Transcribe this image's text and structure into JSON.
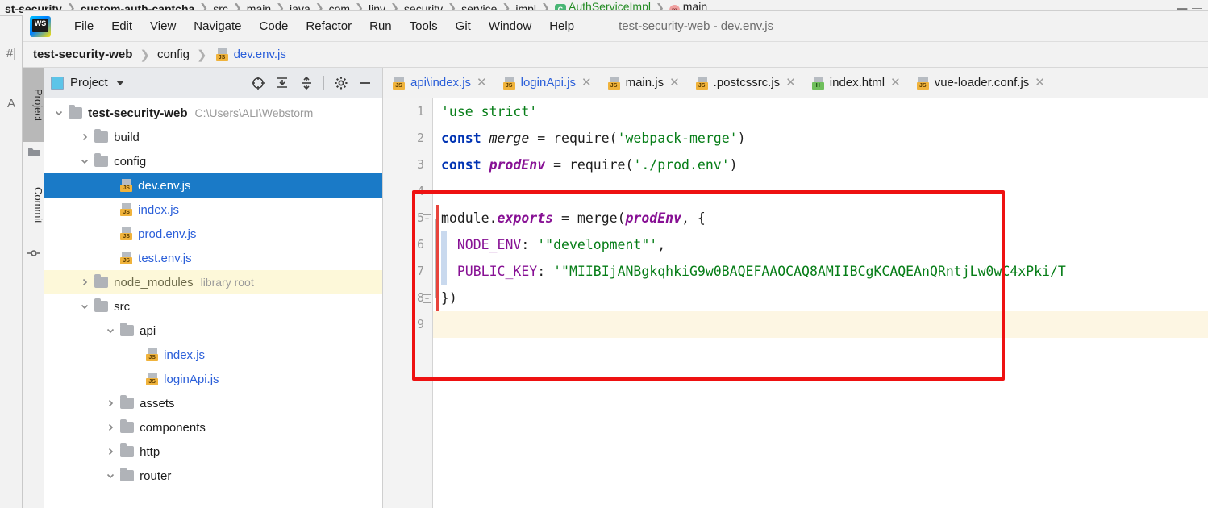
{
  "background_window": {
    "breadcrumb": [
      {
        "text": "st-security",
        "bold": true
      },
      {
        "text": "custom-auth-captcha",
        "bold": true
      },
      {
        "text": "src",
        "bold": false
      },
      {
        "text": "main",
        "bold": false
      },
      {
        "text": "java",
        "bold": false
      },
      {
        "text": "com",
        "bold": false
      },
      {
        "text": "liny",
        "bold": false
      },
      {
        "text": "security",
        "bold": false
      },
      {
        "text": "service",
        "bold": false
      },
      {
        "text": "impl",
        "bold": false
      },
      {
        "text": "AuthServiceImpl",
        "bold": false
      },
      {
        "text": "main",
        "bold": false
      }
    ],
    "left_strip": [
      "#|",
      "A"
    ],
    "window_controls": "▬ —"
  },
  "window": {
    "title": "test-security-web - dev.env.js",
    "logo_text": "WS"
  },
  "menu": {
    "items": [
      {
        "label": "File",
        "mnemonic": "F"
      },
      {
        "label": "Edit",
        "mnemonic": "E"
      },
      {
        "label": "View",
        "mnemonic": "V"
      },
      {
        "label": "Navigate",
        "mnemonic": "N"
      },
      {
        "label": "Code",
        "mnemonic": "C"
      },
      {
        "label": "Refactor",
        "mnemonic": "R"
      },
      {
        "label": "Run",
        "mnemonic": "u"
      },
      {
        "label": "Tools",
        "mnemonic": "T"
      },
      {
        "label": "Git",
        "mnemonic": "G"
      },
      {
        "label": "Window",
        "mnemonic": "W"
      },
      {
        "label": "Help",
        "mnemonic": "H"
      }
    ]
  },
  "navbar": {
    "crumbs": [
      {
        "label": "test-security-web",
        "style": "bold"
      },
      {
        "label": "config",
        "style": "plain"
      },
      {
        "label": "dev.env.js",
        "style": "blue",
        "icon": "js-file-icon"
      }
    ],
    "separator": "❯"
  },
  "toolstrip": {
    "tabs": [
      {
        "label": "Project",
        "active": true,
        "icon": "folder-icon"
      },
      {
        "label": "Commit",
        "active": false,
        "icon": "commit-node-icon"
      }
    ]
  },
  "project_panel": {
    "title": "Project",
    "icons": [
      "locate-target-icon",
      "expand-all-icon",
      "collapse-all-icon",
      "gear-icon",
      "hide-icon"
    ],
    "tree": [
      {
        "depth": 0,
        "arrow": "down",
        "kind": "folder",
        "label": "test-security-web",
        "bold": true,
        "suffix": "C:\\Users\\ALI\\Webstorm"
      },
      {
        "depth": 1,
        "arrow": "right",
        "kind": "folder",
        "label": "build"
      },
      {
        "depth": 1,
        "arrow": "down",
        "kind": "folder",
        "label": "config"
      },
      {
        "depth": 2,
        "arrow": "none",
        "kind": "js",
        "label": "dev.env.js",
        "selected": true
      },
      {
        "depth": 2,
        "arrow": "none",
        "kind": "js",
        "label": "index.js"
      },
      {
        "depth": 2,
        "arrow": "none",
        "kind": "js",
        "label": "prod.env.js"
      },
      {
        "depth": 2,
        "arrow": "none",
        "kind": "js",
        "label": "test.env.js"
      },
      {
        "depth": 1,
        "arrow": "right",
        "kind": "folder",
        "label": "node_modules",
        "suffix": "library root",
        "library": true
      },
      {
        "depth": 1,
        "arrow": "down",
        "kind": "folder",
        "label": "src"
      },
      {
        "depth": 2,
        "arrow": "down",
        "kind": "folder",
        "label": "api"
      },
      {
        "depth": 3,
        "arrow": "none",
        "kind": "js",
        "label": "index.js"
      },
      {
        "depth": 3,
        "arrow": "none",
        "kind": "js",
        "label": "loginApi.js"
      },
      {
        "depth": 2,
        "arrow": "right",
        "kind": "folder",
        "label": "assets"
      },
      {
        "depth": 2,
        "arrow": "right",
        "kind": "folder",
        "label": "components"
      },
      {
        "depth": 2,
        "arrow": "right",
        "kind": "folder",
        "label": "http"
      },
      {
        "depth": 2,
        "arrow": "down",
        "kind": "folder",
        "label": "router"
      }
    ]
  },
  "editor_tabs": [
    {
      "label": "api\\index.js",
      "kind": "js",
      "color": "blue",
      "close": "✕"
    },
    {
      "label": "loginApi.js",
      "kind": "js",
      "color": "blue",
      "close": "✕"
    },
    {
      "label": "main.js",
      "kind": "js",
      "color": "dark",
      "close": "✕"
    },
    {
      "label": ".postcssrc.js",
      "kind": "js",
      "color": "dark",
      "close": "✕"
    },
    {
      "label": "index.html",
      "kind": "html",
      "color": "dark",
      "close": "✕"
    },
    {
      "label": "vue-loader.conf.js",
      "kind": "js",
      "color": "dark",
      "close": "✕"
    }
  ],
  "code": {
    "line_numbers": [
      "1",
      "2",
      "3",
      "4",
      "5",
      "6",
      "7",
      "8",
      "9"
    ],
    "current_line": 9,
    "lines": [
      {
        "n": 1,
        "tokens": [
          {
            "t": "'use strict'",
            "c": "str"
          }
        ]
      },
      {
        "n": 2,
        "tokens": [
          {
            "t": "const ",
            "c": "kw"
          },
          {
            "t": "merge",
            "c": "var"
          },
          {
            "t": " = require(",
            "c": "pl"
          },
          {
            "t": "'webpack-merge'",
            "c": "str"
          },
          {
            "t": ")",
            "c": "pl"
          }
        ]
      },
      {
        "n": 3,
        "tokens": [
          {
            "t": "const ",
            "c": "kw"
          },
          {
            "t": "prodEnv",
            "c": "varp"
          },
          {
            "t": " = require(",
            "c": "pl"
          },
          {
            "t": "'./prod.env'",
            "c": "str"
          },
          {
            "t": ")",
            "c": "pl"
          }
        ]
      },
      {
        "n": 4,
        "tokens": []
      },
      {
        "n": 5,
        "tokens": [
          {
            "t": "module.",
            "c": "pl"
          },
          {
            "t": "exports",
            "c": "varp"
          },
          {
            "t": " = merge(",
            "c": "pl"
          },
          {
            "t": "prodEnv",
            "c": "varp"
          },
          {
            "t": ", {",
            "c": "pl"
          }
        ]
      },
      {
        "n": 6,
        "tokens": [
          {
            "t": "  NODE_ENV",
            "c": "prop"
          },
          {
            "t": ": ",
            "c": "pl"
          },
          {
            "t": "'\"development\"'",
            "c": "str"
          },
          {
            "t": ",",
            "c": "pl"
          }
        ]
      },
      {
        "n": 7,
        "tokens": [
          {
            "t": "  PUBLIC_KEY",
            "c": "prop"
          },
          {
            "t": ": ",
            "c": "pl"
          },
          {
            "t": "'\"MIIBIjANBgkqhkiG9w0BAQEFAAOCAQ8AMIIBCgKCAQEAnQRntjLw0wC4xPki/T",
            "c": "str"
          }
        ]
      },
      {
        "n": 8,
        "tokens": [
          {
            "t": "})",
            "c": "pl"
          }
        ]
      },
      {
        "n": 9,
        "tokens": []
      }
    ]
  },
  "annotation": {
    "type": "red-rectangle-highlight",
    "color": "#ee1111"
  }
}
